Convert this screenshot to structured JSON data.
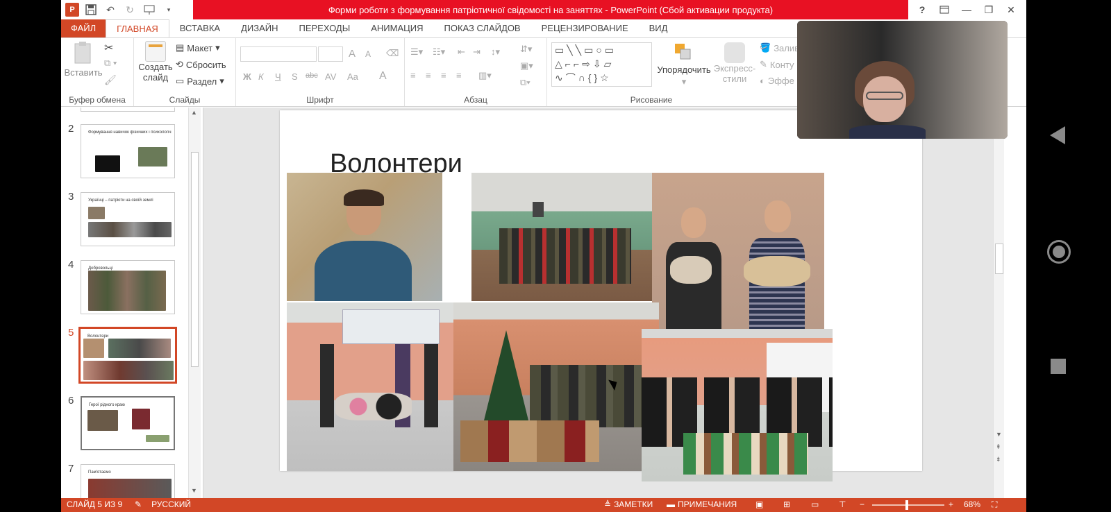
{
  "titlebar": {
    "title": "Форми роботи з формування патріотичної свідомості на заняттях -  PowerPoint (Сбой активации продукта)",
    "help": "?"
  },
  "tabs": [
    "ФАЙЛ",
    "ГЛАВНАЯ",
    "ВСТАВКА",
    "ДИЗАЙН",
    "ПЕРЕХОДЫ",
    "АНИМАЦИЯ",
    "ПОКАЗ СЛАЙДОВ",
    "РЕЦЕНЗИРОВАНИЕ",
    "ВИД"
  ],
  "ribbon": {
    "clipboard": {
      "paste": "Вставить",
      "label": "Буфер обмена"
    },
    "slides": {
      "create": "Создать",
      "create2": "слайд",
      "layout": "Макет",
      "reset": "Сбросить",
      "section": "Раздел",
      "label": "Слайды"
    },
    "font": {
      "bold": "Ж",
      "italic": "К",
      "underline": "Ч",
      "shadow": "S",
      "strike": "abc",
      "spacing": "AV",
      "case": "Aa",
      "color": "A",
      "grow": "A",
      "shrink": "A",
      "label": "Шрифт"
    },
    "paragraph": {
      "label": "Абзац"
    },
    "drawing": {
      "arrange": "Упорядочить",
      "styles": "Экспресс-",
      "styles2": "стили",
      "fill": "Залив",
      "outline": "Конту",
      "effects": "Эффе",
      "label": "Рисование"
    }
  },
  "thumbnails": [
    {
      "num": "2",
      "title": "Формування навичок фізичних і психологічних оборонних..."
    },
    {
      "num": "3",
      "title": "Українці – патріоти на своїй землі"
    },
    {
      "num": "4",
      "title": "Добровольці"
    },
    {
      "num": "5",
      "title": "Волонтери"
    },
    {
      "num": "6",
      "title": "Герої рідного краю"
    },
    {
      "num": "7",
      "title": "Пам'ятаємо"
    }
  ],
  "slide": {
    "title": "Волонтери"
  },
  "statusbar": {
    "slide_info": "СЛАЙД 5 ИЗ 9",
    "language": "РУССКИЙ",
    "notes": "ЗАМЕТКИ",
    "comments": "ПРИМЕЧАНИЯ",
    "zoom": "68%"
  }
}
